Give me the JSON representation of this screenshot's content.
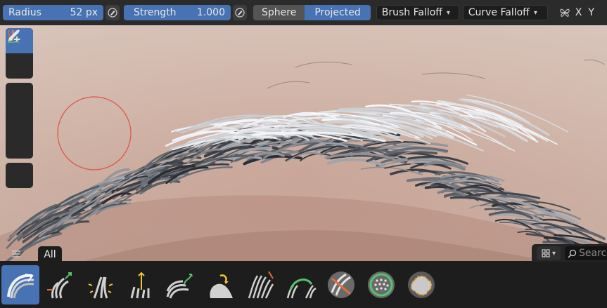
{
  "header": {
    "radius_label": "Radius",
    "radius_value": "52 px",
    "strength_label": "Strength",
    "strength_value": "1.000",
    "mode_sphere": "Sphere",
    "mode_projected": "Projected",
    "brush_falloff": "Brush Falloff",
    "curve_falloff": "Curve Falloff",
    "axis_x": "X",
    "axis_y": "Y",
    "pressure_icon": "pen-pressure-icon",
    "symmetry_icon": "butterfly-icon"
  },
  "tools": [
    {
      "name": "brush-tool",
      "icon": "brush-icon",
      "active": true
    },
    {
      "name": "paint-tool",
      "icon": "brush-dots-icon",
      "active": false
    },
    {
      "name": "draw-curve-tool",
      "icon": "curve-points-icon",
      "active": false
    },
    {
      "name": "add-curves-tool",
      "icon": "curves-add-icon",
      "active": false
    },
    {
      "name": "remove-curves-tool",
      "icon": "curves-remove-icon",
      "active": false
    },
    {
      "name": "annotate-tool",
      "icon": "pencil-icon",
      "active": false
    }
  ],
  "shelf": {
    "menu_icon": "hamburger-icon",
    "tab_label": "All",
    "search_placeholder": "Search",
    "brushes": [
      {
        "icon": "comb-brush-icon",
        "active": true
      },
      {
        "icon": "grow-shrink-brush-icon",
        "active": false
      },
      {
        "icon": "pinch-brush-icon",
        "active": false
      },
      {
        "icon": "add-length-brush-icon",
        "active": false
      },
      {
        "icon": "puff-brush-icon",
        "active": false
      },
      {
        "icon": "slide-brush-icon",
        "active": false
      },
      {
        "icon": "smooth-brush-icon",
        "active": false
      },
      {
        "icon": "snake-hook-brush-icon",
        "active": false
      },
      {
        "icon": "delete-brush-icon",
        "active": false
      },
      {
        "icon": "density-brush-icon",
        "active": false
      },
      {
        "icon": "selection-paint-brush-icon",
        "active": false
      }
    ]
  },
  "colors": {
    "accent": "#4772b3",
    "cursor": "#e2463c",
    "header_bg": "#2b2b2b"
  }
}
